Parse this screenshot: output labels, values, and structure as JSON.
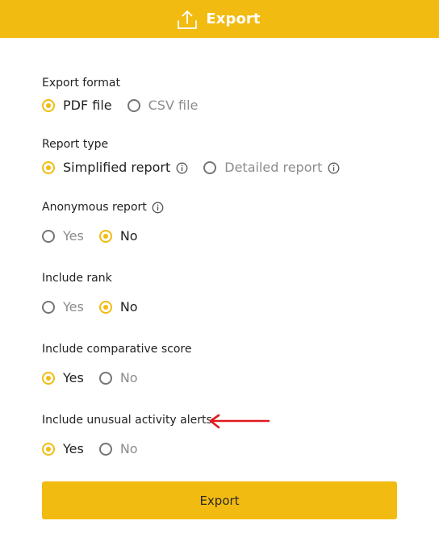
{
  "header": {
    "title": "Export",
    "icon": "upload-icon",
    "color": "#F2BB11"
  },
  "sections": {
    "export_format": {
      "label": "Export format",
      "options": [
        {
          "label": "PDF file",
          "selected": true
        },
        {
          "label": "CSV file",
          "selected": false
        }
      ]
    },
    "report_type": {
      "label": "Report type",
      "options": [
        {
          "label": "Simplified report",
          "selected": true
        },
        {
          "label": "Detailed report",
          "selected": false
        }
      ]
    },
    "anonymous_report": {
      "label": "Anonymous report",
      "options": [
        {
          "label": "Yes",
          "selected": false
        },
        {
          "label": "No",
          "selected": true
        }
      ]
    },
    "include_rank": {
      "label": "Include rank",
      "options": [
        {
          "label": "Yes",
          "selected": false
        },
        {
          "label": "No",
          "selected": true
        }
      ]
    },
    "include_comparative_score": {
      "label": "Include comparative score",
      "options": [
        {
          "label": "Yes",
          "selected": true
        },
        {
          "label": "No",
          "selected": false
        }
      ]
    },
    "include_unusual_activity_alerts": {
      "label": "Include unusual activity alerts",
      "options": [
        {
          "label": "Yes",
          "selected": true
        },
        {
          "label": "No",
          "selected": false
        }
      ]
    }
  },
  "export_button": {
    "label": "Export"
  },
  "annotation": {
    "icon": "red-arrow-left-icon",
    "color": "#E0191E"
  }
}
